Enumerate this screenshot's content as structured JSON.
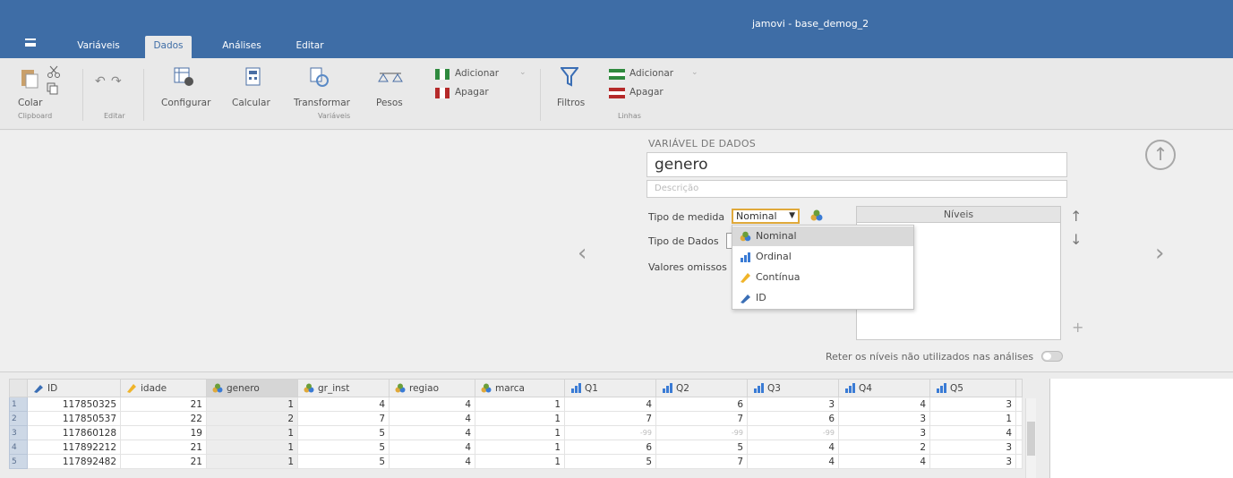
{
  "window": {
    "title": "jamovi - base_demog_2"
  },
  "tabs": [
    {
      "label": "Variáveis"
    },
    {
      "label": "Dados"
    },
    {
      "label": "Análises"
    },
    {
      "label": "Editar"
    }
  ],
  "ribbon": {
    "colar": "Colar",
    "clipboard_group": "Clipboard",
    "editar_group": "Editar",
    "configurar": "Configurar",
    "calcular": "Calcular",
    "transformar": "Transformar",
    "pesos": "Pesos",
    "variaveis_group": "Variáveis",
    "adicionar_var": "Adicionar",
    "apagar_var": "Apagar",
    "filtros": "Filtros",
    "adicionar_linha": "Adicionar",
    "apagar_linha": "Apagar",
    "linhas_group": "Linhas"
  },
  "editor": {
    "heading": "VARIÁVEL DE DADOS",
    "variable_name": "genero",
    "description_placeholder": "Descrição",
    "measure_label": "Tipo de medida",
    "measure_value": "Nominal",
    "datatype_label": "Tipo de Dados",
    "missing_label": "Valores omissos",
    "levels_header": "Níveis",
    "retain_label": "Reter os níveis não utilizados nas análises"
  },
  "dropdown": {
    "options": [
      {
        "label": "Nominal",
        "icon": "nominal-icon",
        "selected": true
      },
      {
        "label": "Ordinal",
        "icon": "ordinal-icon"
      },
      {
        "label": "Contínua",
        "icon": "continuous-icon"
      },
      {
        "label": "ID",
        "icon": "id-icon"
      }
    ]
  },
  "grid": {
    "columns": [
      {
        "label": "ID",
        "type": "id"
      },
      {
        "label": "idade",
        "type": "continuous"
      },
      {
        "label": "genero",
        "type": "nominal"
      },
      {
        "label": "gr_inst",
        "type": "nominal"
      },
      {
        "label": "regiao",
        "type": "nominal"
      },
      {
        "label": "marca",
        "type": "nominal"
      },
      {
        "label": "Q1",
        "type": "ordinal"
      },
      {
        "label": "Q2",
        "type": "ordinal"
      },
      {
        "label": "Q3",
        "type": "ordinal"
      },
      {
        "label": "Q4",
        "type": "ordinal"
      },
      {
        "label": "Q5",
        "type": "ordinal"
      }
    ],
    "rows": [
      {
        "num": "1",
        "cells": [
          "117850325",
          "21",
          "1",
          "4",
          "4",
          "1",
          "4",
          "6",
          "3",
          "4",
          "3"
        ]
      },
      {
        "num": "2",
        "cells": [
          "117850537",
          "22",
          "2",
          "7",
          "4",
          "1",
          "7",
          "7",
          "6",
          "3",
          "1"
        ]
      },
      {
        "num": "3",
        "cells": [
          "117860128",
          "19",
          "1",
          "5",
          "4",
          "1",
          "-99",
          "-99",
          "-99",
          "3",
          "4"
        ]
      },
      {
        "num": "4",
        "cells": [
          "117892212",
          "21",
          "1",
          "5",
          "4",
          "1",
          "6",
          "5",
          "4",
          "2",
          "3"
        ]
      },
      {
        "num": "5",
        "cells": [
          "117892482",
          "21",
          "1",
          "5",
          "4",
          "1",
          "5",
          "7",
          "4",
          "4",
          "3"
        ]
      }
    ],
    "missing_value": "-99"
  },
  "colors": {
    "title_bar": "#3e6da6",
    "nominal_icon": "#e0a93a",
    "ordinal_icon": "#3a7bd5",
    "continuous_icon": "#f0b429",
    "selection_border": "#e0a93a"
  }
}
